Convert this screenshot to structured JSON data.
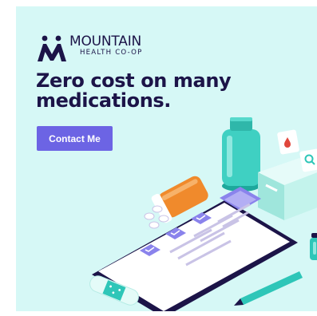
{
  "ad": {
    "brand": {
      "name": "MOUNTAIN",
      "subtitle": "HEALTH CO-OP"
    },
    "headline": "Zero cost on many medications.",
    "cta_label": "Contact Me"
  },
  "colors": {
    "background": "#d6f8f6",
    "navy": "#1c1448",
    "cta": "#6c64e4",
    "teal": "#2ec6b8",
    "orange": "#f08a2c"
  },
  "icons": [
    "mountain-logo-icon",
    "blood-drop-icon",
    "magnifier-icon",
    "checkmark-icon"
  ]
}
